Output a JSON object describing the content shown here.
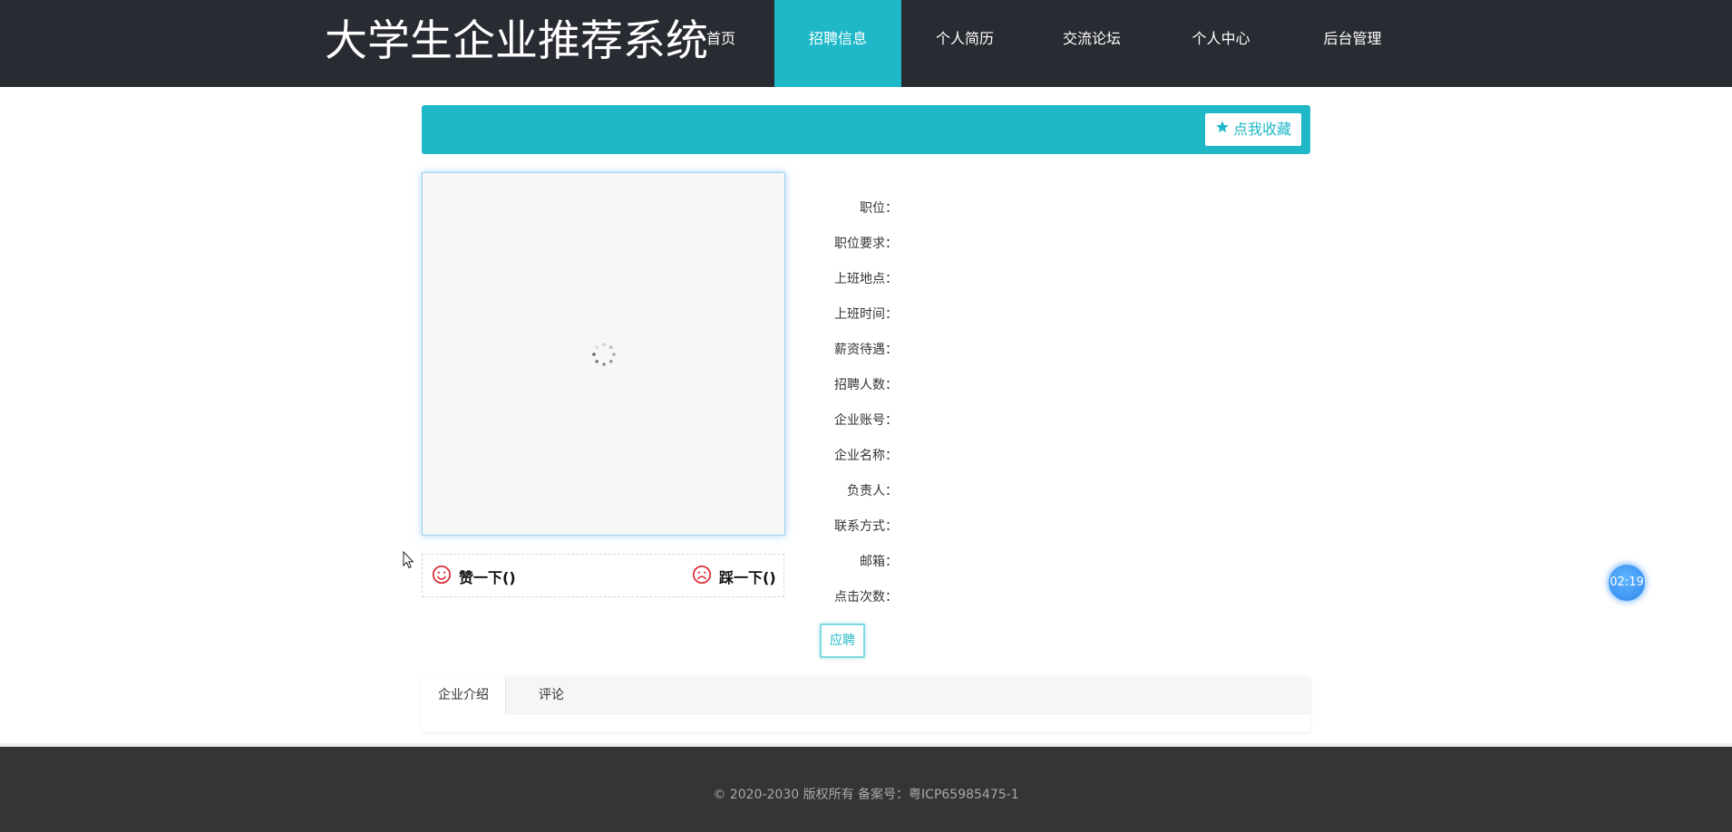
{
  "header": {
    "logo": "大学生企业推荐系统",
    "nav": [
      {
        "label": "首页",
        "active": false
      },
      {
        "label": "招聘信息",
        "active": true
      },
      {
        "label": "个人简历",
        "active": false
      },
      {
        "label": "交流论坛",
        "active": false
      },
      {
        "label": "个人中心",
        "active": false
      },
      {
        "label": "后台管理",
        "active": false
      }
    ]
  },
  "detail": {
    "favorite_label": "点我收藏",
    "like_label": "赞一下()",
    "dislike_label": "踩一下()",
    "fields": [
      "职位：",
      "职位要求：",
      "上班地点：",
      "上班时间：",
      "薪资待遇：",
      "招聘人数：",
      "企业账号：",
      "企业名称：",
      "负责人：",
      "联系方式：",
      "邮箱：",
      "点击次数："
    ],
    "apply_label": "应聘"
  },
  "tabs": [
    {
      "label": "企业介绍",
      "active": true
    },
    {
      "label": "评论",
      "active": false
    }
  ],
  "timer": "02:19",
  "footer": "© 2020-2030 版权所有 备案号：粤ICP65985475-1",
  "colors": {
    "header_bg": "#292b33",
    "accent": "#1fb8c8",
    "footer_bg": "#353535",
    "vote_icon": "#d9252b",
    "timer_bg": "#2f86ec"
  },
  "icons": {
    "favorite": "star-icon",
    "like": "smile-icon",
    "dislike": "frown-icon",
    "loading": "spinner-icon"
  }
}
